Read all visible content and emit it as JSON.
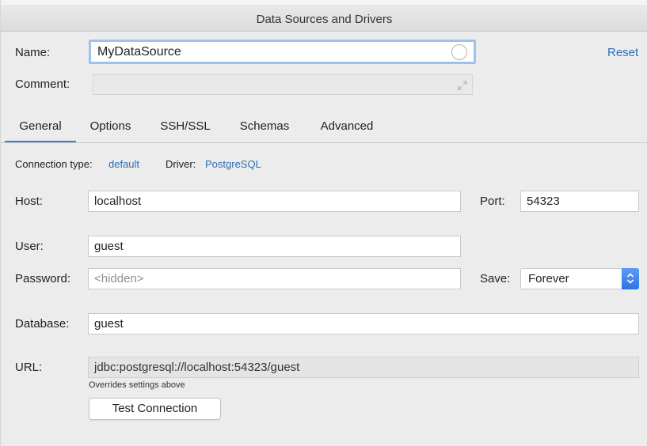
{
  "window": {
    "title": "Data Sources and Drivers"
  },
  "name": {
    "label": "Name:",
    "value": "MyDataSource",
    "reset_label": "Reset"
  },
  "comment": {
    "label": "Comment:",
    "value": ""
  },
  "tabs": [
    {
      "label": "General",
      "active": true
    },
    {
      "label": "Options",
      "active": false
    },
    {
      "label": "SSH/SSL",
      "active": false
    },
    {
      "label": "Schemas",
      "active": false
    },
    {
      "label": "Advanced",
      "active": false
    }
  ],
  "connection": {
    "type_label": "Connection type:",
    "type_value": "default",
    "driver_label": "Driver:",
    "driver_value": "PostgreSQL"
  },
  "host": {
    "label": "Host:",
    "value": "localhost"
  },
  "port": {
    "label": "Port:",
    "value": "54323"
  },
  "user": {
    "label": "User:",
    "value": "guest"
  },
  "password": {
    "label": "Password:",
    "placeholder": "<hidden>"
  },
  "save": {
    "label": "Save:",
    "value": "Forever"
  },
  "database": {
    "label": "Database:",
    "value": "guest"
  },
  "url": {
    "label": "URL:",
    "value": "jdbc:postgresql://localhost:54323/guest",
    "note": "Overrides settings above"
  },
  "test_button": {
    "label": "Test Connection"
  },
  "colors": {
    "accent": "#3f7fce",
    "link": "#2c6fb7",
    "focus_ring": "#9cc3ee"
  },
  "icons": {
    "name_field": "circle-icon",
    "comment_field": "expand-icon",
    "save_select": "chevron-updown-icon"
  }
}
